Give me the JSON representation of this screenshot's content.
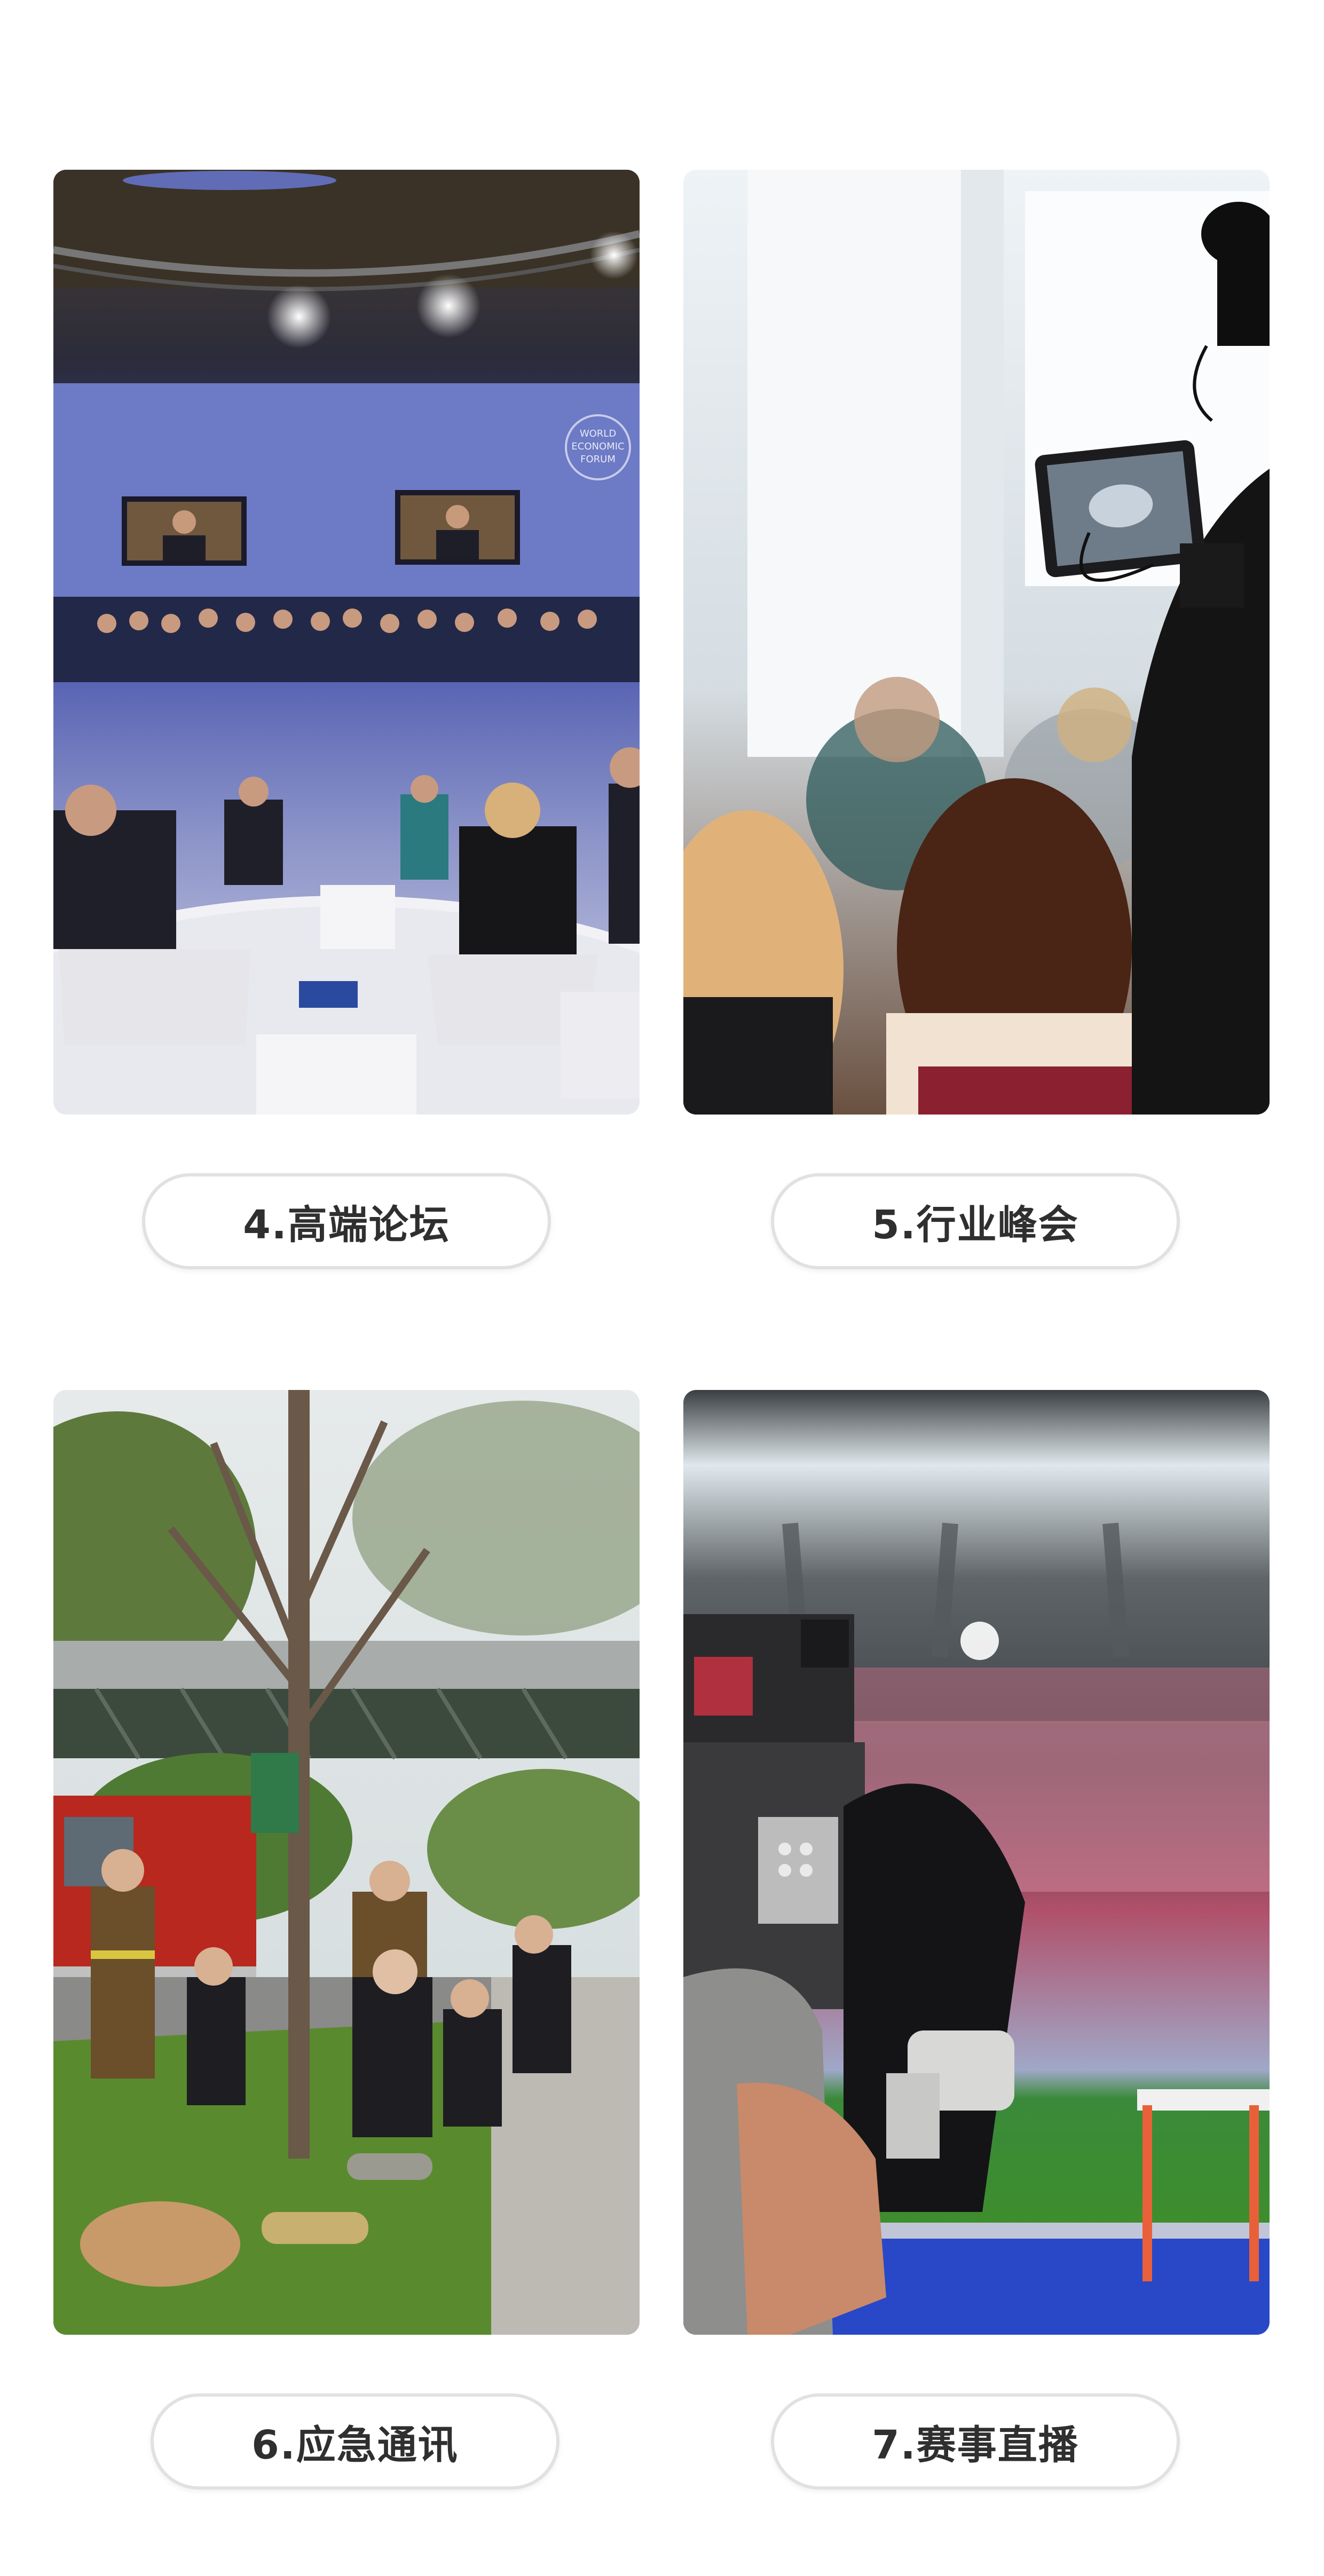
{
  "items": [
    {
      "label": "4.高端论坛",
      "photo": "forum-stage-photo"
    },
    {
      "label": "5.行业峰会",
      "photo": "summit-camera-photo"
    },
    {
      "label": "6.应急通讯",
      "photo": "firefighters-photo"
    },
    {
      "label": "7.赛事直播",
      "photo": "stadium-broadcast-photo"
    }
  ],
  "forum_photo": {
    "logo_text": [
      "WORLD",
      "ECONOMIC",
      "FORUM"
    ]
  },
  "colors": {
    "background": "#ffffff",
    "pill_border": "#e1e1e1",
    "label_text": "#2f2f2f"
  }
}
